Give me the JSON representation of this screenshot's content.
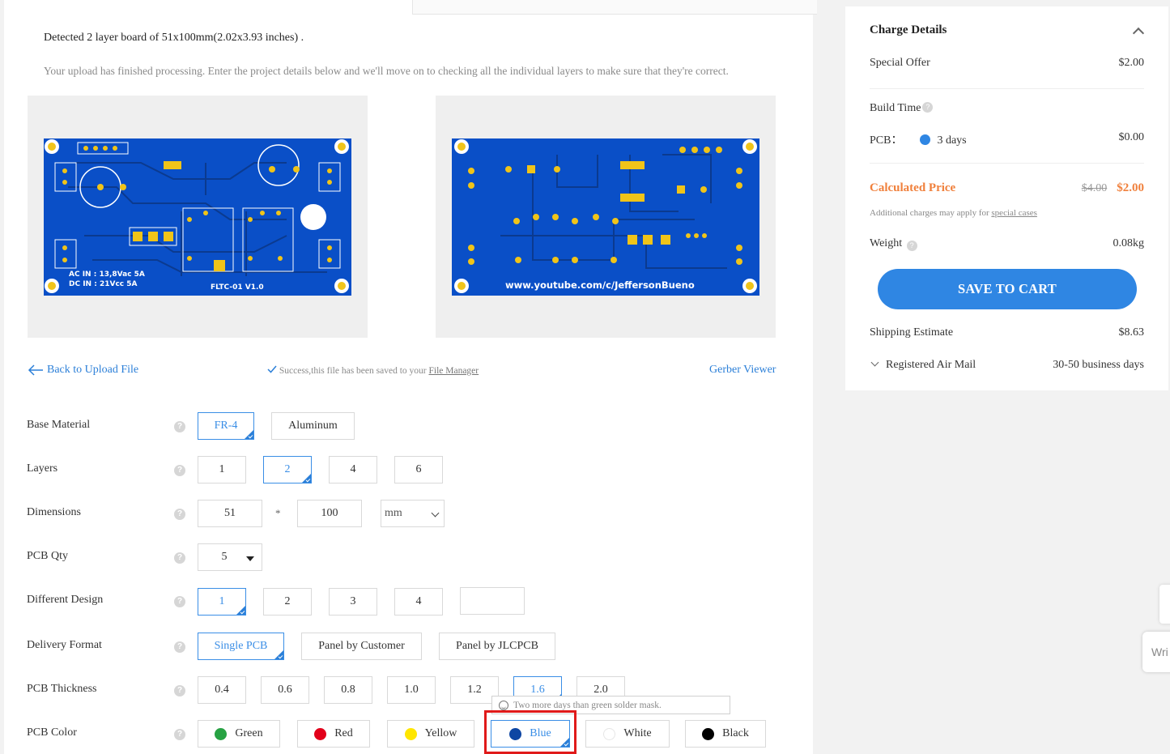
{
  "upload": {
    "detected": "Detected 2 layer board of 51x100mm(2.02x3.93 inches) .",
    "processing": "Your upload has finished processing. Enter the project details below and we'll move on to checking all the individual layers to make sure that they're correct.",
    "front_text_1": "AC IN : 13,8Vac 5A",
    "front_text_2": "DC IN : 21Vcc 5A",
    "front_text_3": "FLTC-01 V1.0",
    "back_text": "www.youtube.com/c/JeffersonBueno",
    "back_link": "Back to Upload File",
    "success_text": "Success,this file has been saved to your",
    "file_manager": "File Manager",
    "gerber_viewer": "Gerber Viewer"
  },
  "options": {
    "base_material": {
      "label": "Base Material",
      "choices": [
        "FR-4",
        "Aluminum"
      ]
    },
    "layers": {
      "label": "Layers",
      "choices": [
        "1",
        "2",
        "4",
        "6"
      ]
    },
    "dimensions": {
      "label": "Dimensions",
      "width": "51",
      "height": "100",
      "separator": "*",
      "unit": "mm"
    },
    "pcb_qty": {
      "label": "PCB Qty",
      "value": "5"
    },
    "different_design": {
      "label": "Different Design",
      "choices": [
        "1",
        "2",
        "3",
        "4"
      ],
      "custom": ""
    },
    "delivery_format": {
      "label": "Delivery Format",
      "choices": [
        "Single PCB",
        "Panel by Customer",
        "Panel by JLCPCB"
      ]
    },
    "pcb_thickness": {
      "label": "PCB Thickness",
      "choices": [
        "0.4",
        "0.6",
        "0.8",
        "1.0",
        "1.2",
        "1.6",
        "2.0"
      ]
    },
    "pcb_color": {
      "label": "PCB Color",
      "choices": [
        {
          "name": "Green",
          "color": "#27a243"
        },
        {
          "name": "Red",
          "color": "#e2001a"
        },
        {
          "name": "Yellow",
          "color": "#ffe600"
        },
        {
          "name": "Blue",
          "color": "#0e46a3"
        },
        {
          "name": "White",
          "color": "#ffffff"
        },
        {
          "name": "Black",
          "color": "#000000"
        }
      ],
      "tooltip": "Two more days than green solder mask."
    }
  },
  "charge": {
    "title": "Charge Details",
    "special_offer": {
      "label": "Special Offer",
      "value": "$2.00"
    },
    "build_time": {
      "label": "Build Time"
    },
    "pcb": {
      "label": "PCB：",
      "option": "3 days",
      "value": "$0.00"
    },
    "calculated": {
      "label": "Calculated Price",
      "old": "$4.00",
      "new": "$2.00"
    },
    "note": "Additional charges may apply for",
    "note_link": "special cases",
    "weight": {
      "label": "Weight",
      "value": "0.08kg"
    },
    "save_button": "SAVE TO CART",
    "shipping": {
      "label": "Shipping Estimate",
      "value": "$8.63"
    },
    "mail": {
      "label": "Registered Air Mail",
      "value": "30-50 business days"
    }
  },
  "edge_widget": {
    "text": "Wri"
  },
  "colors": {
    "accent": "#2f86e3",
    "price": "#f0803c",
    "pcb_blue": "#0a4fc7",
    "pad_gold": "#f0c419"
  }
}
